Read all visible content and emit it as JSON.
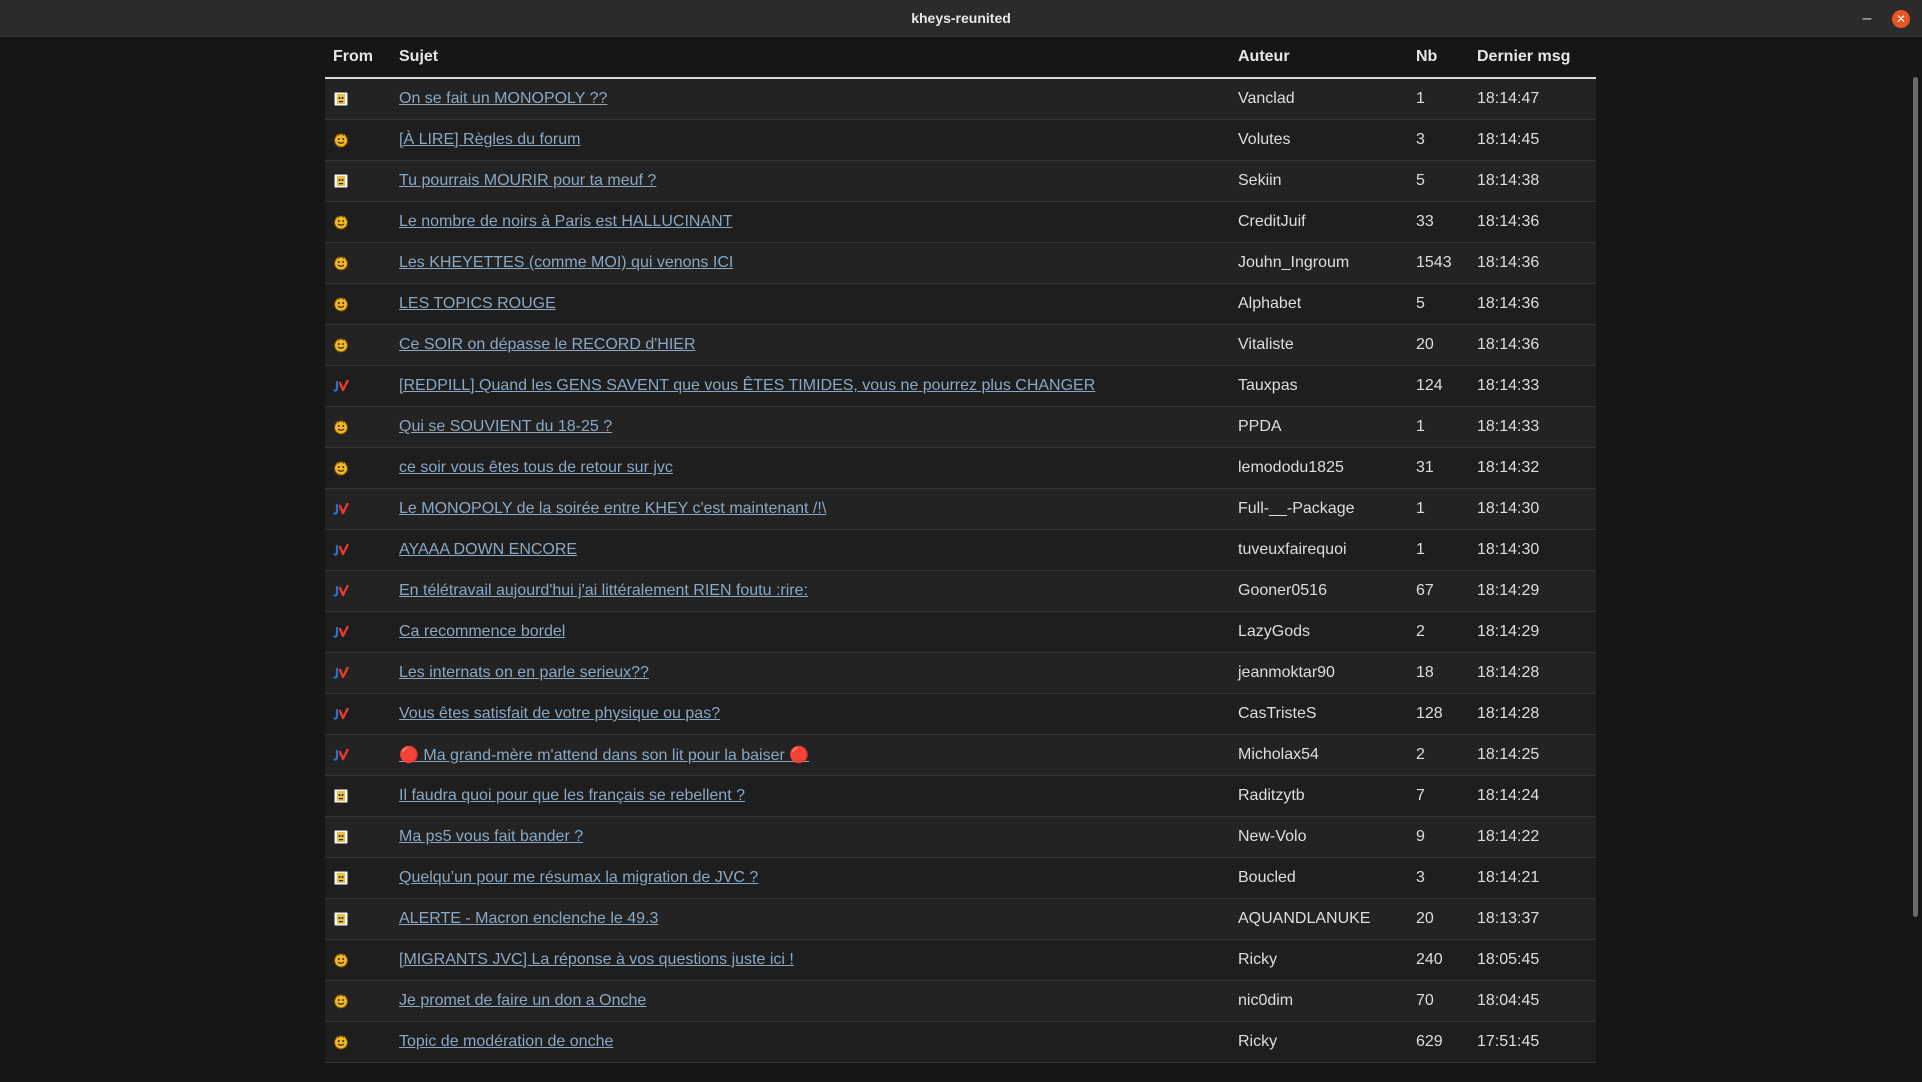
{
  "window": {
    "title": "kheys-reunited",
    "minimize_glyph": "–",
    "close_glyph": "✕"
  },
  "table": {
    "headers": {
      "from": "From",
      "sujet": "Sujet",
      "auteur": "Auteur",
      "nb": "Nb",
      "dernier": "Dernier msg"
    },
    "rows": [
      {
        "from": "aquali-icon",
        "sujet": "On se fait un MONOPOLY ??",
        "auteur": "Vanclad",
        "nb": "1",
        "dernier": "18:14:47"
      },
      {
        "from": "onche-icon",
        "sujet": "[À LIRE] Règles du forum",
        "auteur": "Volutes",
        "nb": "3",
        "dernier": "18:14:45"
      },
      {
        "from": "aquali-icon",
        "sujet": "Tu pourrais MOURIR pour ta meuf ?",
        "auteur": "Sekiin",
        "nb": "5",
        "dernier": "18:14:38"
      },
      {
        "from": "onche-icon",
        "sujet": "Le nombre de noirs à Paris est HALLUCINANT",
        "auteur": "CreditJuif",
        "nb": "33",
        "dernier": "18:14:36"
      },
      {
        "from": "onche-icon",
        "sujet": "Les KHEYETTES (comme MOI) qui venons ICI",
        "auteur": "Jouhn_Ingroum",
        "nb": "1543",
        "dernier": "18:14:36"
      },
      {
        "from": "onche-icon",
        "sujet": "LES TOPICS ROUGE",
        "auteur": "Alphabet",
        "nb": "5",
        "dernier": "18:14:36"
      },
      {
        "from": "onche-icon",
        "sujet": "Ce SOIR on dépasse le RECORD d'HIER",
        "auteur": "Vitaliste",
        "nb": "20",
        "dernier": "18:14:36"
      },
      {
        "from": "jvc-icon",
        "sujet": "[REDPILL] Quand les GENS SAVENT que vous ÊTES TIMIDES, vous ne pourrez plus CHANGER",
        "auteur": "Tauxpas",
        "nb": "124",
        "dernier": "18:14:33"
      },
      {
        "from": "onche-icon",
        "sujet": "Qui se SOUVIENT du 18-25 ?",
        "auteur": "PPDA",
        "nb": "1",
        "dernier": "18:14:33"
      },
      {
        "from": "onche-icon",
        "sujet": "ce soir vous êtes tous de retour sur jvc",
        "auteur": "lemododu1825",
        "nb": "31",
        "dernier": "18:14:32"
      },
      {
        "from": "jvc-icon",
        "sujet": "Le MONOPOLY de la soirée entre KHEY c'est maintenant /!\\",
        "auteur": "Full-__-Package",
        "nb": "1",
        "dernier": "18:14:30"
      },
      {
        "from": "jvc-icon",
        "sujet": "AYAAA DOWN ENCORE",
        "auteur": "tuveuxfairequoi",
        "nb": "1",
        "dernier": "18:14:30"
      },
      {
        "from": "jvc-icon",
        "sujet": "En télétravail aujourd'hui j'ai littéralement RIEN foutu :rire:",
        "auteur": "Gooner0516",
        "nb": "67",
        "dernier": "18:14:29"
      },
      {
        "from": "jvc-icon",
        "sujet": "Ca recommence bordel",
        "auteur": "LazyGods",
        "nb": "2",
        "dernier": "18:14:29"
      },
      {
        "from": "jvc-icon",
        "sujet": "Les internats on en parle serieux??",
        "auteur": "jeanmoktar90",
        "nb": "18",
        "dernier": "18:14:28"
      },
      {
        "from": "jvc-icon",
        "sujet": "Vous êtes satisfait de votre physique ou pas?",
        "auteur": "CasTristeS",
        "nb": "128",
        "dernier": "18:14:28"
      },
      {
        "from": "jvc-icon",
        "sujet": "🔴 Ma grand-mère m'attend dans son lit pour la baiser 🔴",
        "auteur": "Micholax54",
        "nb": "2",
        "dernier": "18:14:25"
      },
      {
        "from": "aquali-icon",
        "sujet": "Il faudra quoi pour que les français se rebellent ?",
        "auteur": "Raditzytb",
        "nb": "7",
        "dernier": "18:14:24"
      },
      {
        "from": "aquali-icon",
        "sujet": "Ma ps5 vous fait bander ?",
        "auteur": "New-Volo",
        "nb": "9",
        "dernier": "18:14:22"
      },
      {
        "from": "aquali-icon",
        "sujet": "Quelqu’un pour me résumax la migration de JVC ?",
        "auteur": "Boucled",
        "nb": "3",
        "dernier": "18:14:21"
      },
      {
        "from": "aquali-icon",
        "sujet": "ALERTE - Macron enclenche le 49.3",
        "auteur": "AQUANDLANUKE",
        "nb": "20",
        "dernier": "18:13:37"
      },
      {
        "from": "onche-icon",
        "sujet": "[MIGRANTS JVC] La réponse à vos questions juste ici !",
        "auteur": "Ricky",
        "nb": "240",
        "dernier": "18:05:45"
      },
      {
        "from": "onche-icon",
        "sujet": "Je promet de faire un don a Onche",
        "auteur": "nic0dim",
        "nb": "70",
        "dernier": "18:04:45"
      },
      {
        "from": "onche-icon",
        "sujet": "Topic de modération de onche",
        "auteur": "Ricky",
        "nb": "629",
        "dernier": "17:51:45"
      }
    ]
  }
}
